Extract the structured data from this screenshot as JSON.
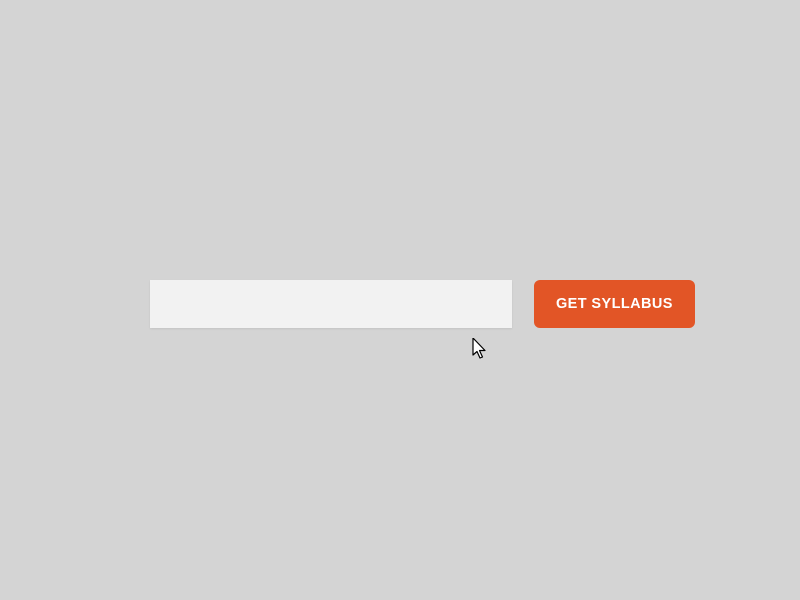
{
  "form": {
    "input": {
      "value": "",
      "placeholder": ""
    },
    "button_label": "GET SYLLABUS"
  },
  "colors": {
    "background": "#d4d4d4",
    "input_bg": "#f2f2f2",
    "button_bg": "#e25526",
    "button_text": "#ffffff"
  }
}
